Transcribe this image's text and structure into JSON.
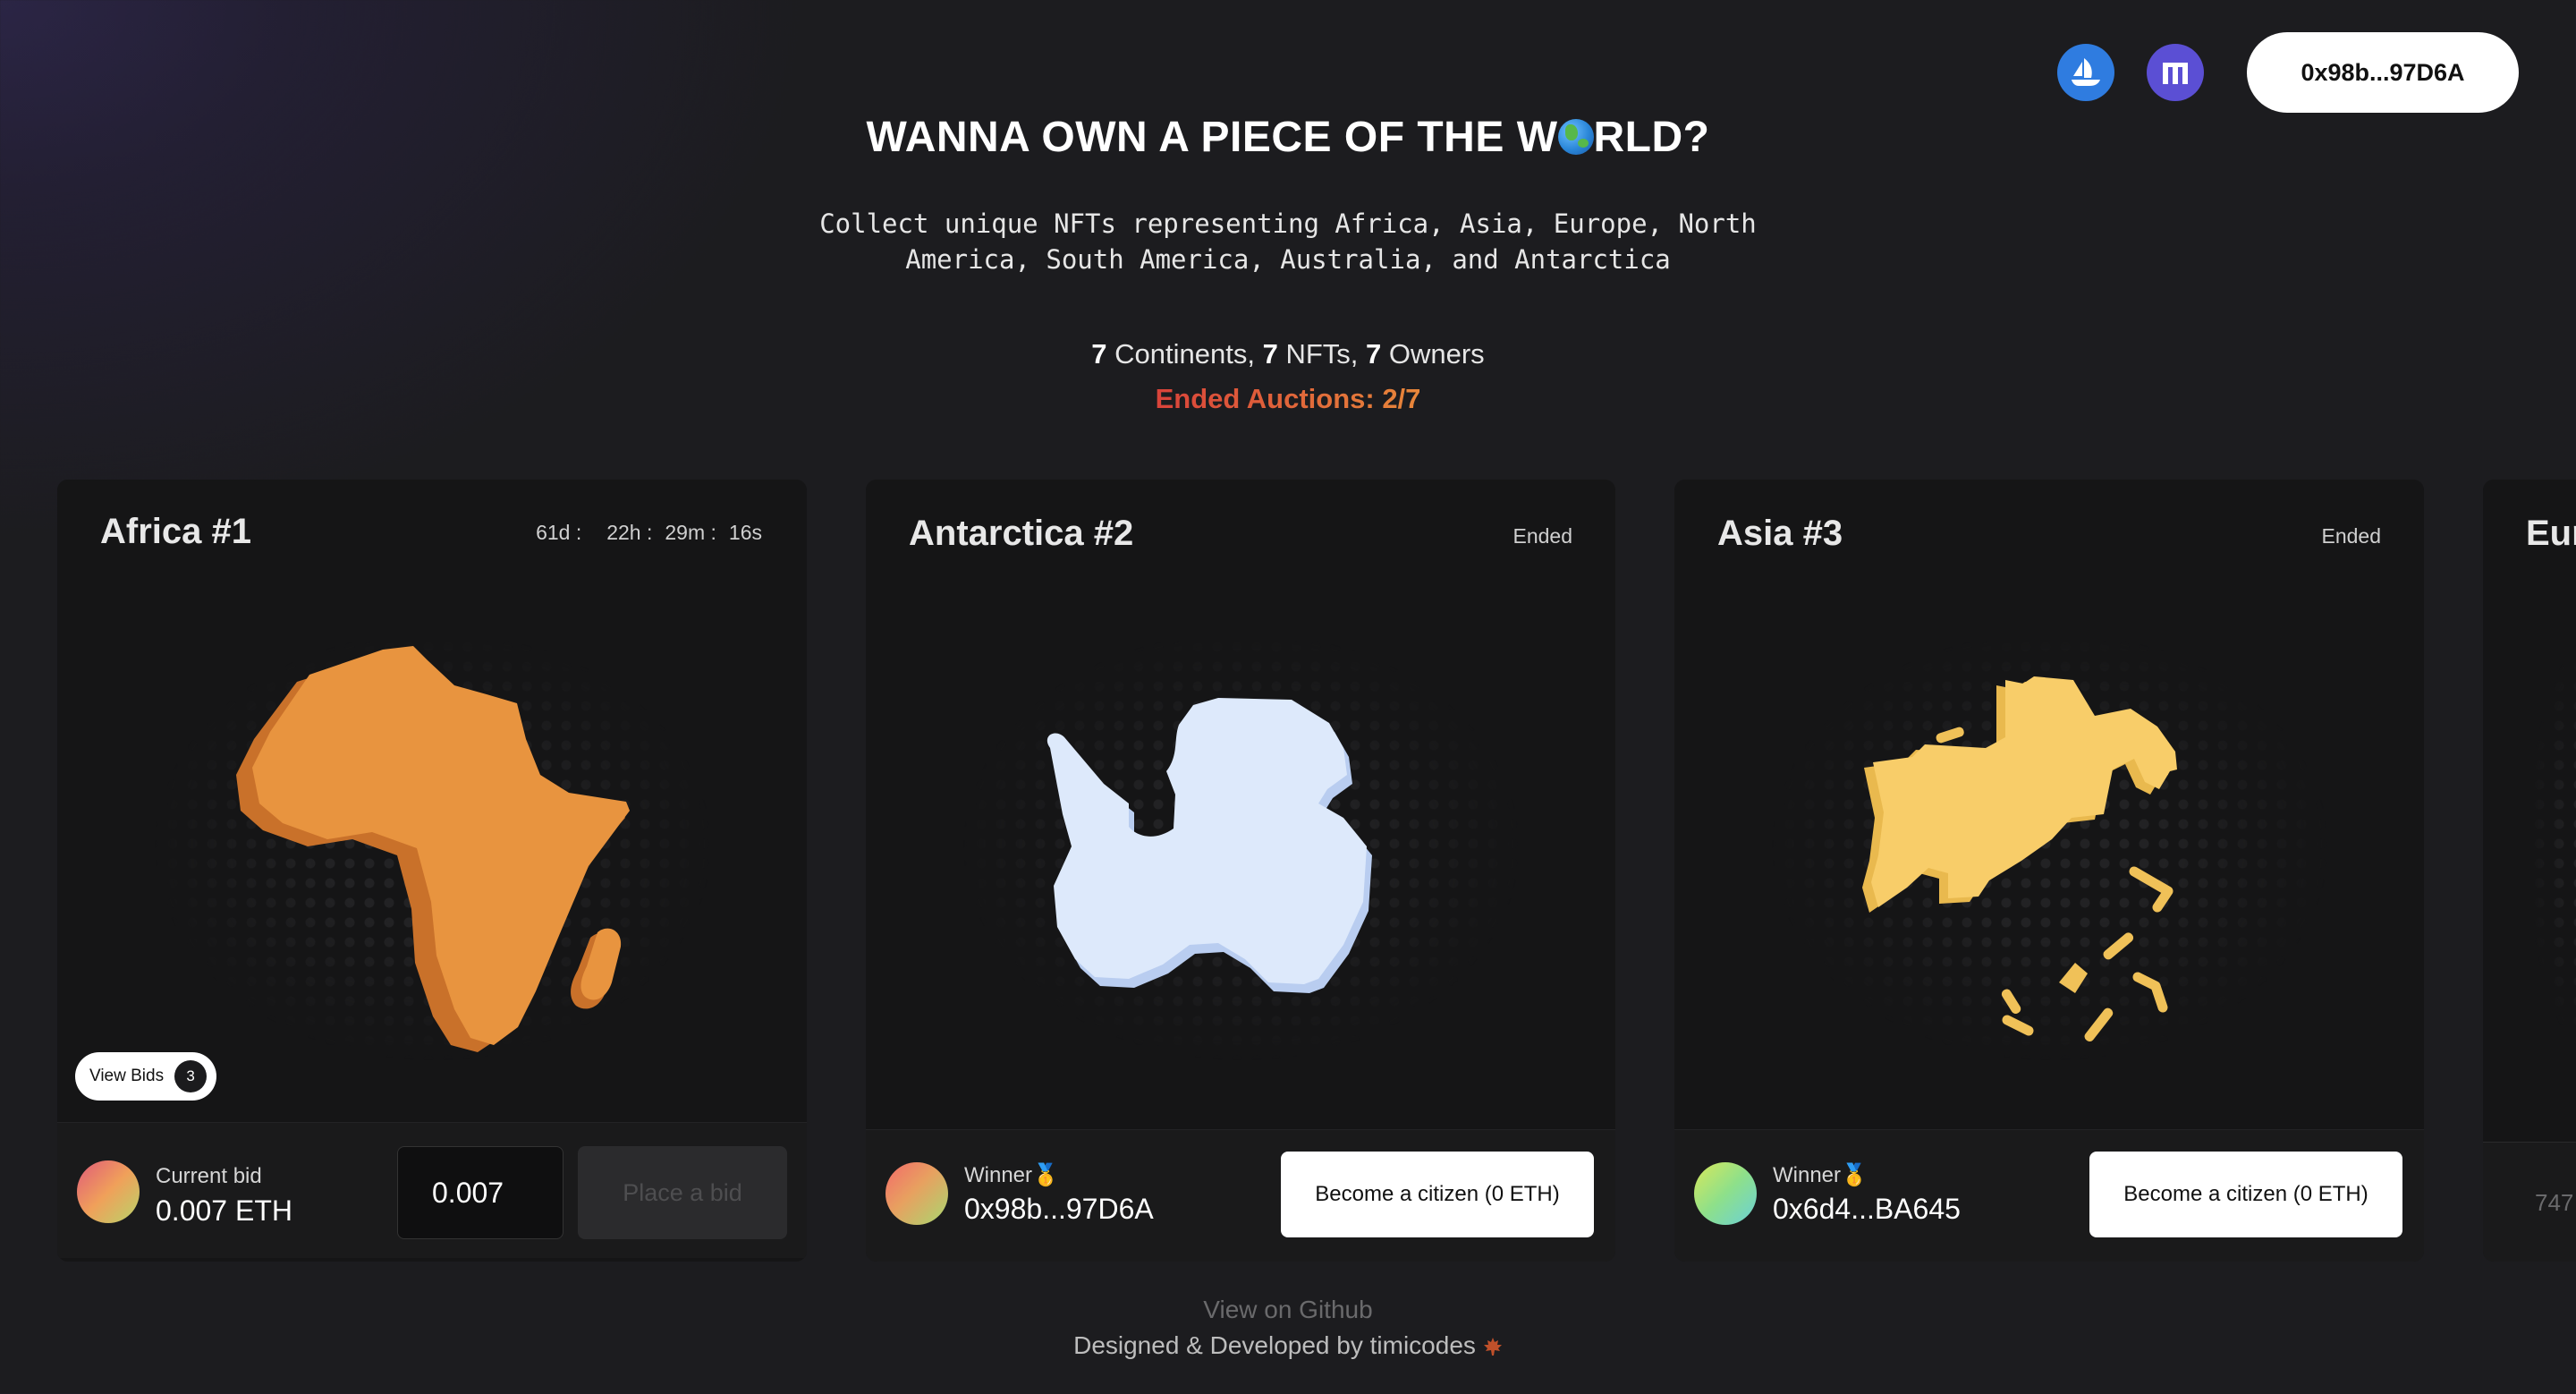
{
  "header": {
    "opensea_icon": "opensea-icon",
    "rarible_icon": "rarible-icon",
    "wallet_address": "0x98b...97D6A"
  },
  "hero": {
    "title_part1": "WANNA OWN A PIECE OF THE W",
    "title_part2": "RLD?",
    "subtitle": "Collect unique NFTs representing Africa, Asia, Europe, North America, South America, Australia, and Antarctica"
  },
  "stats": {
    "continents_count": "7",
    "continents_label": " Continents, ",
    "nfts_count": "7",
    "nfts_label": " NFTs, ",
    "owners_count": "7",
    "owners_label": " Owners",
    "ended_auctions": "Ended Auctions: 2/7"
  },
  "cards": [
    {
      "title": "Africa #1",
      "timer": {
        "days": "61d :",
        "hours": "22h :",
        "minutes": "29m :",
        "seconds": "16s"
      },
      "view_bids_label": "View Bids",
      "bid_count": "3",
      "footer_label": "Current bid",
      "footer_value": "0.007 ETH",
      "bid_input_value": "0.007",
      "place_bid_label": "Place a bid",
      "color": "#e8943f"
    },
    {
      "title": "Antarctica #2",
      "status": "Ended",
      "footer_label": "Winner🥇",
      "footer_value": "0x98b...97D6A",
      "action_label": "Become a citizen (0 ETH)",
      "color": "#dde9fb"
    },
    {
      "title": "Asia #3",
      "status": "Ended",
      "footer_label": "Winner🥇",
      "footer_value": "0x6d4...BA645",
      "action_label": "Become a citizen (0 ETH)",
      "color": "#f8cd69"
    },
    {
      "title": "Eur",
      "footer_value": "747"
    }
  ],
  "footer": {
    "github_link": "View on Github",
    "credit": "Designed & Developed by timicodes"
  }
}
